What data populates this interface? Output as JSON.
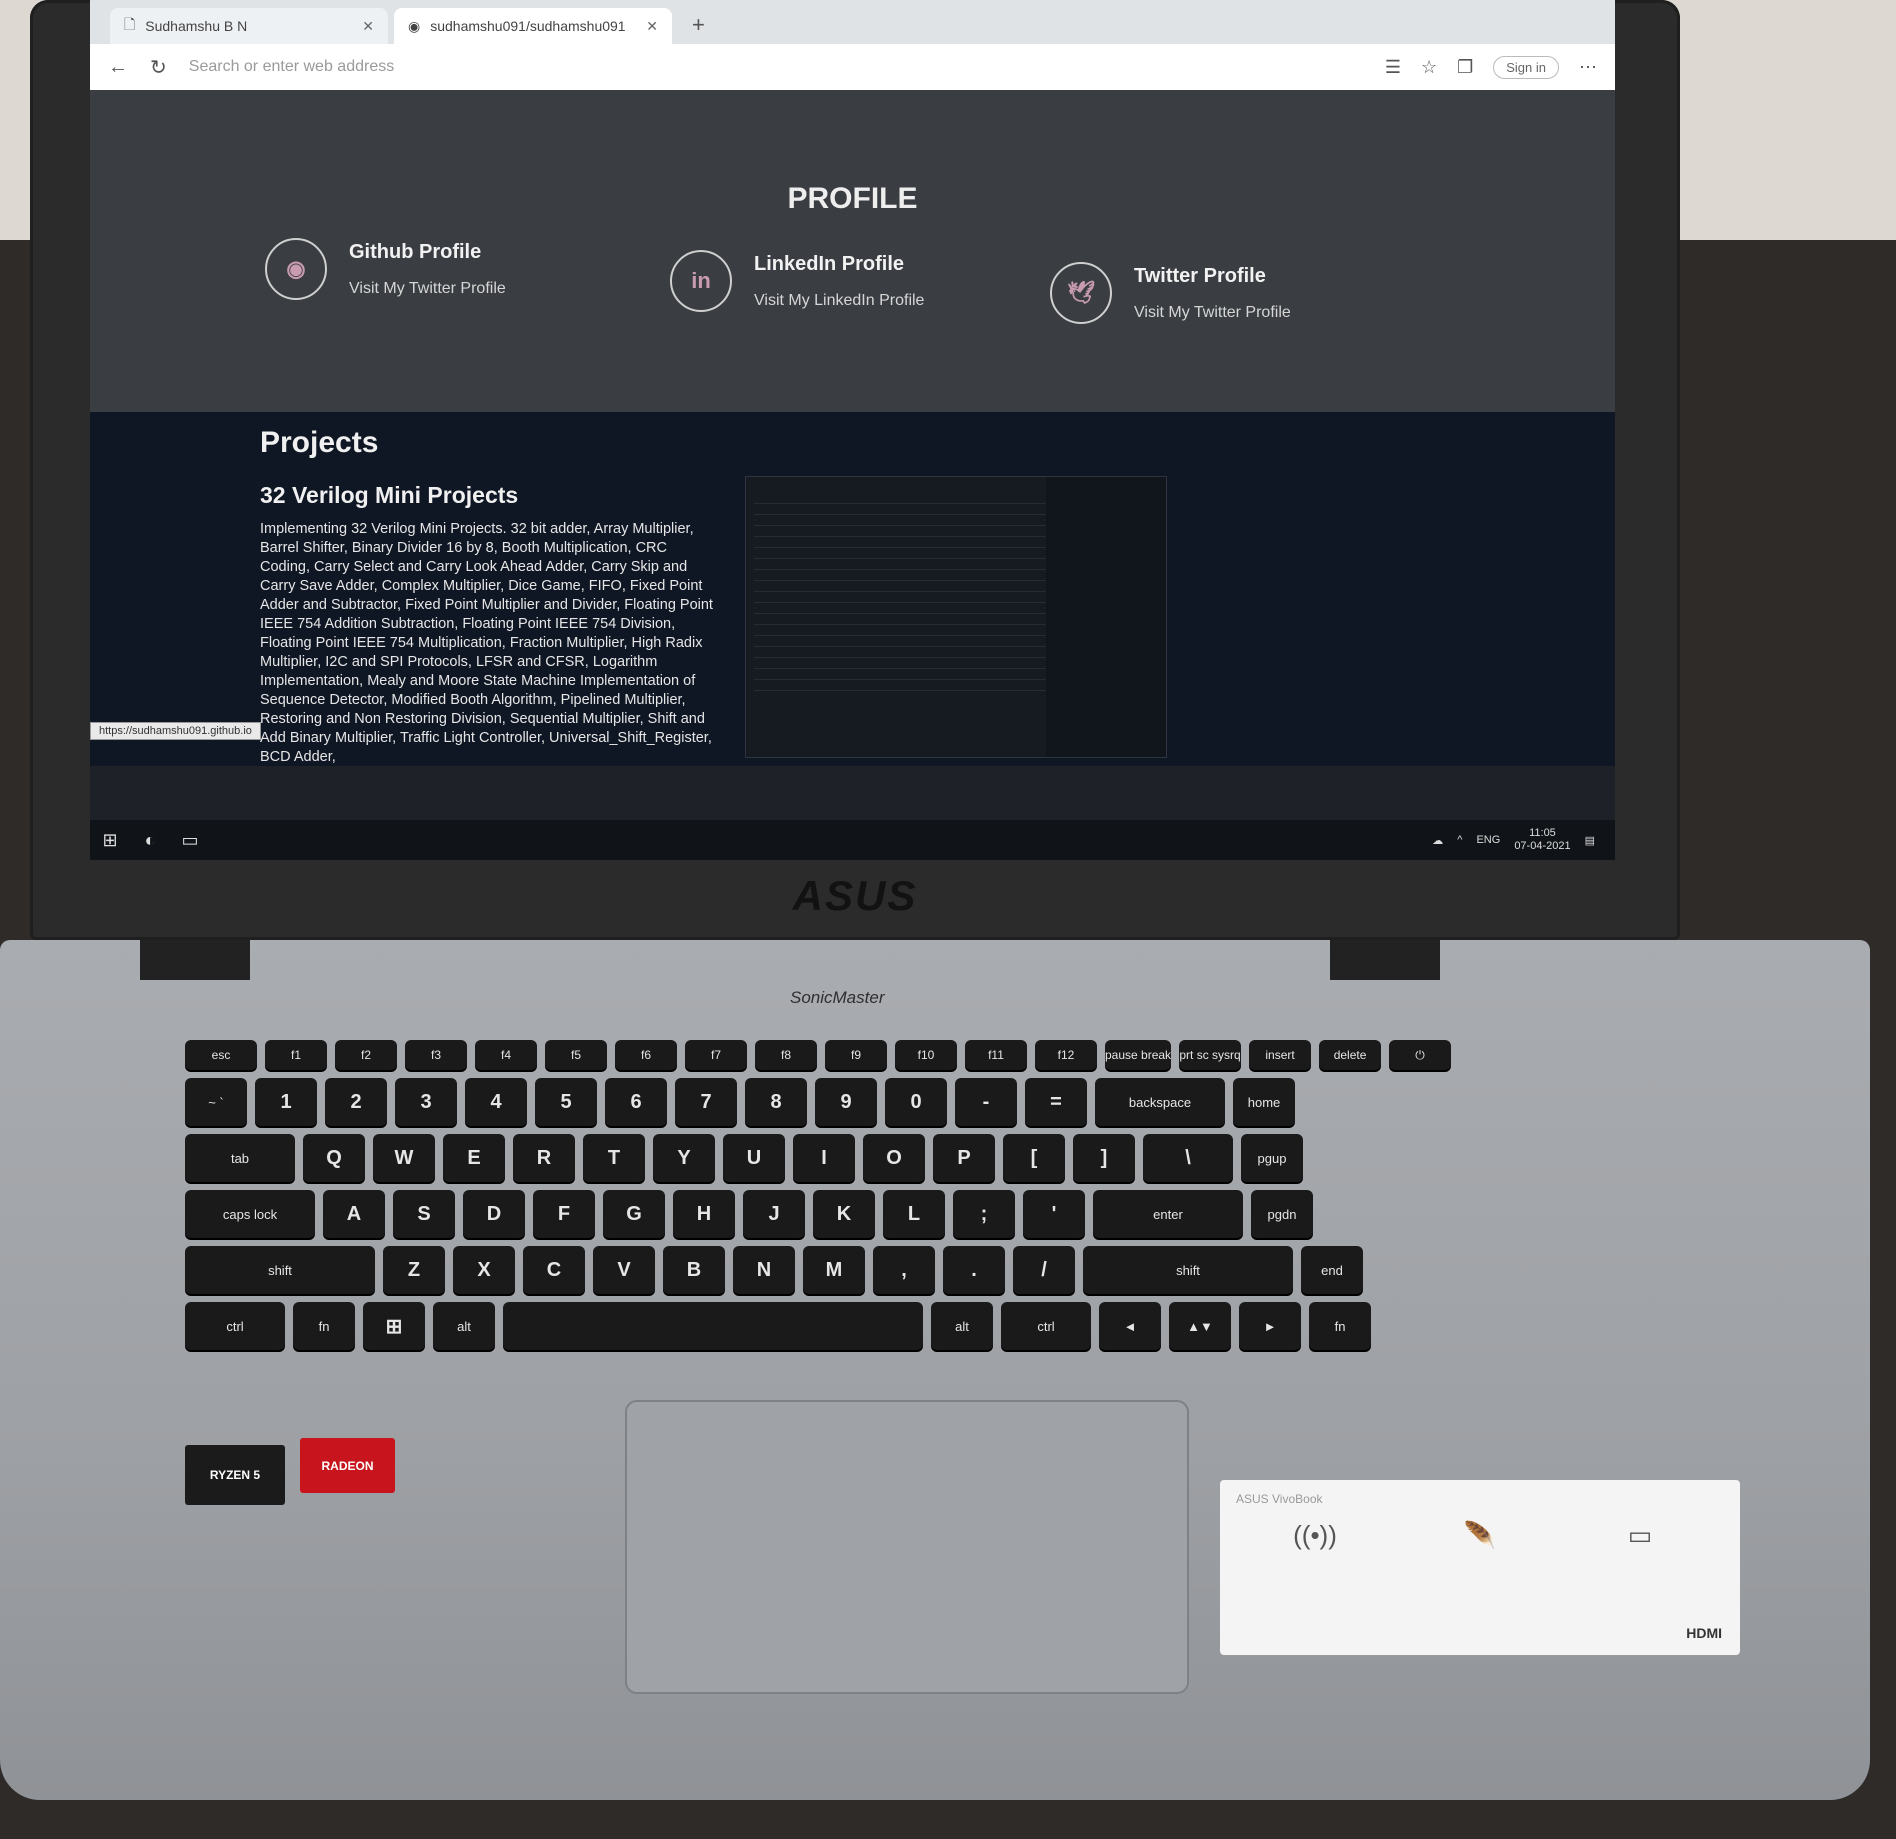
{
  "browser": {
    "tabs": [
      {
        "label": "Sudhamshu B N",
        "active": false
      },
      {
        "label": "sudhamshu091/sudhamshu091",
        "active": true
      }
    ],
    "address_placeholder": "Search or enter web address",
    "signin_label": "Sign in"
  },
  "profile": {
    "title": "PROFILE",
    "cards": [
      {
        "icon": "github-icon",
        "title": "Github Profile",
        "subtitle": "Visit My Twitter Profile"
      },
      {
        "icon": "linkedin-icon",
        "glyph": "in",
        "title": "LinkedIn Profile",
        "subtitle": "Visit My LinkedIn Profile"
      },
      {
        "icon": "twitter-icon",
        "title": "Twitter Profile",
        "subtitle": "Visit My Twitter Profile"
      }
    ]
  },
  "projects": {
    "heading": "Projects",
    "items": [
      {
        "name": "32 Verilog Mini Projects",
        "description": "Implementing 32 Verilog Mini Projects. 32 bit adder, Array Multiplier, Barrel Shifter, Binary Divider 16 by 8, Booth Multiplication, CRC Coding, Carry Select and Carry Look Ahead Adder, Carry Skip and Carry Save Adder, Complex Multiplier, Dice Game, FIFO, Fixed Point Adder and Subtractor, Fixed Point Multiplier and Divider, Floating Point IEEE 754 Addition Subtraction, Floating Point IEEE 754 Division, Floating Point IEEE 754 Multiplication, Fraction Multiplier, High Radix Multiplier, I2C and SPI Protocols, LFSR and CFSR, Logarithm Implementation, Mealy and Moore State Machine Implementation of Sequence Detector, Modified Booth Algorithm, Pipelined Multiplier, Restoring and Non Restoring Division, Sequential Multiplier, Shift and Add Binary Multiplier, Traffic Light Controller, Universal_Shift_Register, BCD Adder,"
      }
    ]
  },
  "status_link": "https://sudhamshu091.github.io",
  "taskbar": {
    "language": "ENG",
    "time": "11:05",
    "date": "07-04-2021"
  },
  "hardware": {
    "brand": "ASUS",
    "sonic": "SonicMaster",
    "sticker_ryzen": "RYZEN 5",
    "sticker_radeon": "RADEON",
    "vivobook": "ASUS VivoBook",
    "hdmi": "HDMI"
  },
  "keyboard": {
    "fn_row": [
      "esc",
      "f1",
      "f2",
      "f3",
      "f4",
      "f5",
      "f6",
      "f7",
      "f8",
      "f9",
      "f10",
      "f11",
      "f12",
      "pause break",
      "prt sc sysrq",
      "insert",
      "delete"
    ],
    "row1": [
      "~ `",
      "1",
      "2",
      "3",
      "4",
      "5",
      "6",
      "7",
      "8",
      "9",
      "0",
      "-",
      "=",
      "backspace",
      "home"
    ],
    "row2": [
      "tab",
      "Q",
      "W",
      "E",
      "R",
      "T",
      "Y",
      "U",
      "I",
      "O",
      "P",
      "[",
      "]",
      "\\",
      "pgup"
    ],
    "row3": [
      "caps lock",
      "A",
      "S",
      "D",
      "F",
      "G",
      "H",
      "J",
      "K",
      "L",
      ";",
      "'",
      "enter",
      "pgdn"
    ],
    "row4": [
      "shift",
      "Z",
      "X",
      "C",
      "V",
      "B",
      "N",
      "M",
      ",",
      ".",
      "/",
      "shift",
      "end"
    ],
    "row5": [
      "ctrl",
      "fn",
      "win",
      "alt",
      "",
      "alt",
      "ctrl",
      "◄",
      "▲▼",
      "►",
      "fn"
    ]
  }
}
